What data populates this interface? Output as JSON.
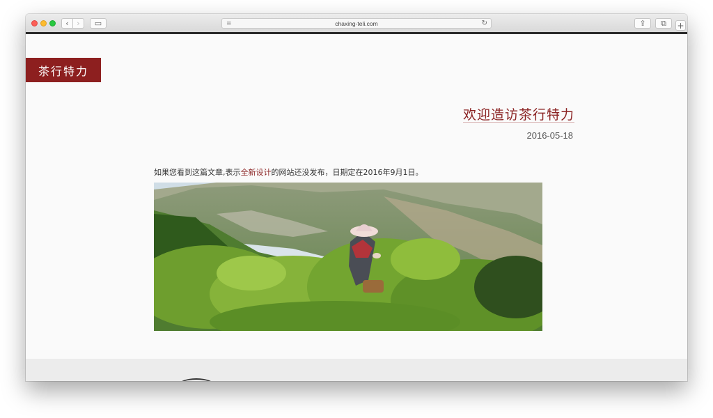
{
  "browser": {
    "url": "chaxing-teli.com",
    "back_glyph": "‹",
    "forward_glyph": "›",
    "sidebar_glyph": "▭",
    "reader_glyph": "≡",
    "reload_glyph": "↻",
    "share_glyph": "⇪",
    "tabs_glyph": "⧉",
    "newtab_glyph": "+"
  },
  "site": {
    "logo": "茶行特力"
  },
  "article": {
    "title": "欢迎造访茶行特力",
    "date": "2016-05-18",
    "text_before": "如果您看到这篇文章,表示",
    "text_link": "全新设计",
    "text_after": "的网站还没发布，日期定在2016年9月1日。"
  },
  "colors": {
    "brand": "#8d1f1f",
    "title": "#8b2323"
  },
  "icons": [
    "reader-icon",
    "reload-icon",
    "share-icon",
    "tabs-icon",
    "sidebar-icon"
  ]
}
